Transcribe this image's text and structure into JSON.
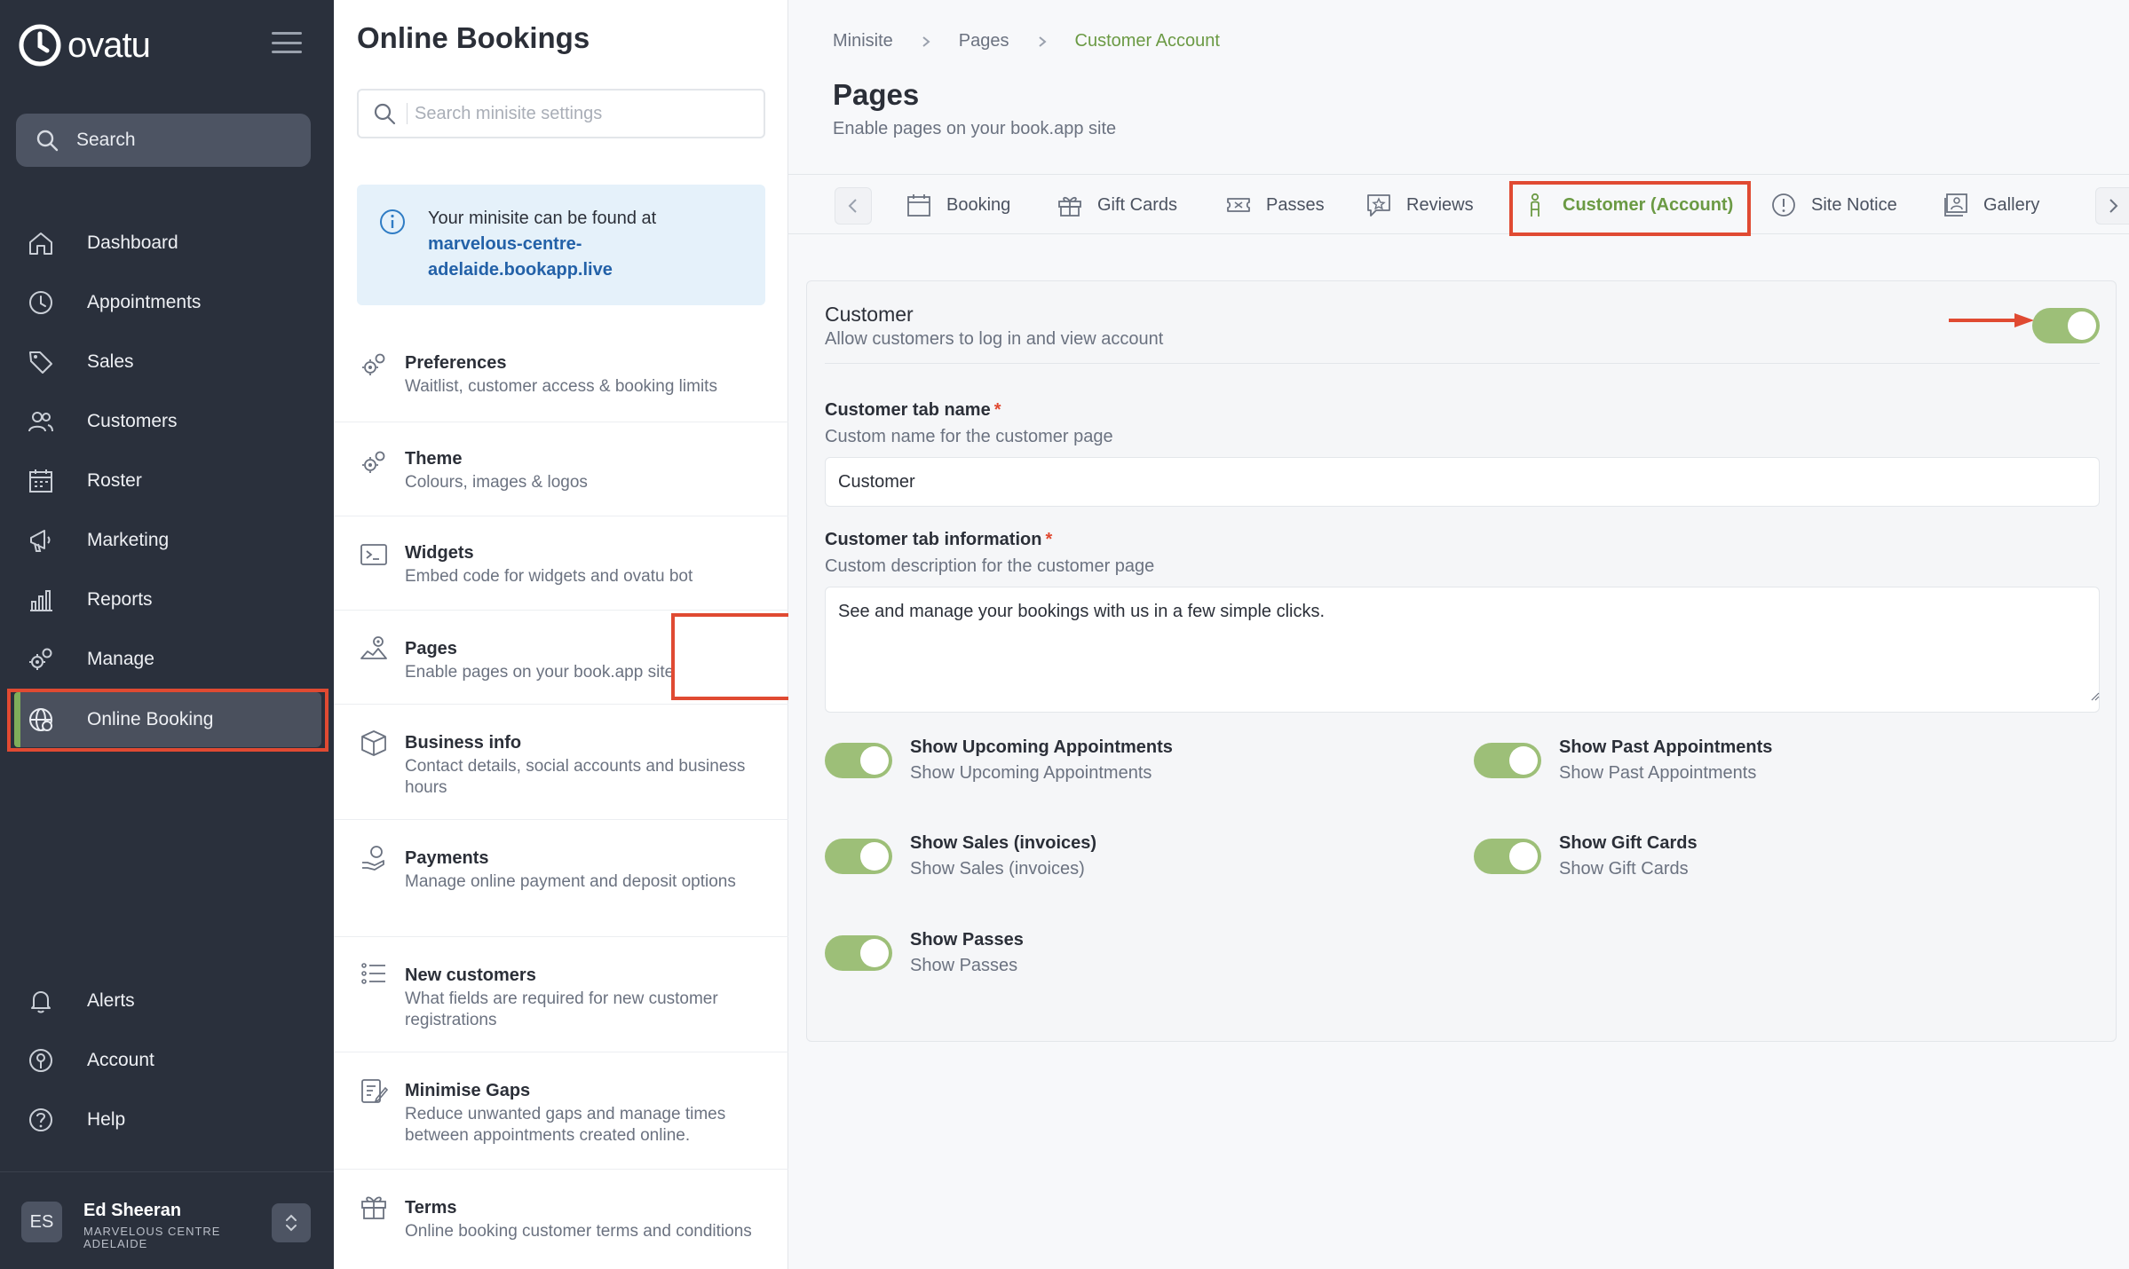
{
  "brand": {
    "name": "ovatu"
  },
  "sidebar": {
    "search_label": "Search",
    "items": [
      {
        "label": "Dashboard",
        "icon": "home-icon"
      },
      {
        "label": "Appointments",
        "icon": "clock-icon"
      },
      {
        "label": "Sales",
        "icon": "tag-icon"
      },
      {
        "label": "Customers",
        "icon": "users-icon"
      },
      {
        "label": "Roster",
        "icon": "calendar-icon"
      },
      {
        "label": "Marketing",
        "icon": "megaphone-icon"
      },
      {
        "label": "Reports",
        "icon": "bar-chart-icon"
      },
      {
        "label": "Manage",
        "icon": "gears-icon"
      },
      {
        "label": "Online Booking",
        "icon": "globe-gear-icon",
        "active": true
      }
    ],
    "bottom_items": [
      {
        "label": "Alerts",
        "icon": "bell-icon"
      },
      {
        "label": "Account",
        "icon": "account-icon"
      },
      {
        "label": "Help",
        "icon": "help-icon"
      }
    ],
    "user": {
      "initials": "ES",
      "name": "Ed Sheeran",
      "org_line1": "MARVELOUS CENTRE",
      "org_line2": "ADELAIDE"
    }
  },
  "settings": {
    "title": "Online Bookings",
    "search_placeholder": "Search minisite settings",
    "info_text": "Your minisite can be found at",
    "info_link_line1": "marvelous-centre-",
    "info_link_line2": "adelaide.bookapp.live",
    "items": [
      {
        "title": "Preferences",
        "desc": "Waitlist, customer access & booking limits",
        "icon": "settings-gear-icon"
      },
      {
        "title": "Theme",
        "desc": "Colours, images & logos",
        "icon": "palette-gear-icon"
      },
      {
        "title": "Widgets",
        "desc": "Embed code for widgets and ovatu bot",
        "icon": "terminal-icon"
      },
      {
        "title": "Pages",
        "desc": "Enable pages on your book.app site",
        "icon": "pages-gear-icon",
        "active": true
      },
      {
        "title": "Business info",
        "desc": "Contact details, social accounts and business hours",
        "icon": "box-icon"
      },
      {
        "title": "Payments",
        "desc": "Manage online payment and deposit options",
        "icon": "payment-hand-icon"
      },
      {
        "title": "New customers",
        "desc": "What fields are required for new customer registrations",
        "icon": "list-icon"
      },
      {
        "title": "Minimise Gaps",
        "desc": "Reduce unwanted gaps and manage times between appointments created online.",
        "icon": "edit-clipboard-icon"
      },
      {
        "title": "Terms",
        "desc": "Online booking customer terms and conditions",
        "icon": "gift-icon"
      }
    ]
  },
  "main": {
    "breadcrumb": [
      "Minisite",
      "Pages",
      "Customer Account"
    ],
    "title": "Pages",
    "subtitle": "Enable pages on your book.app site",
    "tabs": [
      {
        "label": "Booking",
        "icon": "calendar-icon"
      },
      {
        "label": "Gift Cards",
        "icon": "gift-card-icon"
      },
      {
        "label": "Passes",
        "icon": "ticket-icon"
      },
      {
        "label": "Reviews",
        "icon": "star-chat-icon"
      },
      {
        "label": "Customer (Account)",
        "icon": "person-icon",
        "active": true
      },
      {
        "label": "Site Notice",
        "icon": "alert-circle-icon"
      },
      {
        "label": "Gallery",
        "icon": "gallery-icon"
      }
    ],
    "customer": {
      "title": "Customer",
      "subtitle": "Allow customers to log in and view account",
      "enabled": true,
      "tab_name_label": "Customer tab name",
      "tab_name_desc": "Custom name for the customer page",
      "tab_name_value": "Customer",
      "tab_info_label": "Customer tab information",
      "tab_info_desc": "Custom description for the customer page",
      "tab_info_value": "See and manage your bookings with us in a few simple clicks.",
      "options": [
        {
          "title": "Show Upcoming Appointments",
          "desc": "Show Upcoming Appointments",
          "enabled": true
        },
        {
          "title": "Show Past Appointments",
          "desc": "Show Past Appointments",
          "enabled": true
        },
        {
          "title": "Show Sales (invoices)",
          "desc": "Show Sales (invoices)",
          "enabled": true
        },
        {
          "title": "Show Gift Cards",
          "desc": "Show Gift Cards",
          "enabled": true
        },
        {
          "title": "Show Passes",
          "desc": "Show Passes",
          "enabled": true
        }
      ]
    }
  },
  "colors": {
    "accent_green": "#7fae5a",
    "highlight_red": "#e04a32",
    "sidebar_bg": "#2a303c",
    "link_blue": "#2361a8"
  }
}
